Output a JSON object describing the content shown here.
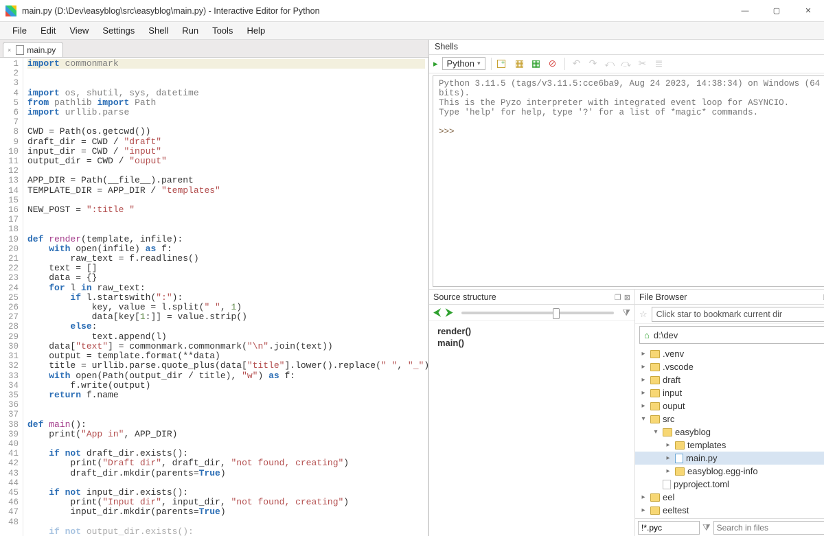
{
  "window": {
    "title": "main.py (D:\\Dev\\easyblog\\src\\easyblog\\main.py) - Interactive Editor for Python"
  },
  "menu": {
    "items": [
      "File",
      "Edit",
      "View",
      "Settings",
      "Shell",
      "Run",
      "Tools",
      "Help"
    ]
  },
  "tab": {
    "filename": "main.py"
  },
  "code_lines": [
    {
      "n": 1,
      "html": "<span class='kw'>import</span> <span class='ident'>commonmark</span>",
      "hl": true
    },
    {
      "n": 2,
      "html": ""
    },
    {
      "n": 3,
      "html": "<span class='kw'>import</span> <span class='ident'>os, shutil, sys, datetime</span>"
    },
    {
      "n": 4,
      "html": "<span class='kw'>from</span> <span class='ident'>pathlib</span> <span class='kw'>import</span> <span class='ident'>Path</span>"
    },
    {
      "n": 5,
      "html": "<span class='kw'>import</span> <span class='ident'>urllib.parse</span>"
    },
    {
      "n": 6,
      "html": ""
    },
    {
      "n": 7,
      "html": "CWD = Path(os.getcwd())"
    },
    {
      "n": 8,
      "html": "draft_dir = CWD / <span class='str'>\"draft\"</span>"
    },
    {
      "n": 9,
      "html": "input_dir = CWD / <span class='str'>\"input\"</span>"
    },
    {
      "n": 10,
      "html": "output_dir = CWD / <span class='str'>\"ouput\"</span>"
    },
    {
      "n": 11,
      "html": ""
    },
    {
      "n": 12,
      "html": "APP_DIR = Path(__file__).parent"
    },
    {
      "n": 13,
      "html": "TEMPLATE_DIR = APP_DIR / <span class='str'>\"templates\"</span>"
    },
    {
      "n": 14,
      "html": ""
    },
    {
      "n": 15,
      "html": "NEW_POST = <span class='str'>\":title \"</span>"
    },
    {
      "n": 16,
      "html": ""
    },
    {
      "n": 17,
      "html": ""
    },
    {
      "n": 18,
      "html": "<span class='kw'>def</span> <span class='fn'>render</span>(template, infile):"
    },
    {
      "n": 19,
      "html": "    <span class='kw'>with</span> open(infile) <span class='kw'>as</span> f:"
    },
    {
      "n": 20,
      "html": "        raw_text = f.readlines()"
    },
    {
      "n": 21,
      "html": "    text = []"
    },
    {
      "n": 22,
      "html": "    data = {}"
    },
    {
      "n": 23,
      "html": "    <span class='kw'>for</span> l <span class='kw'>in</span> raw_text:"
    },
    {
      "n": 24,
      "html": "        <span class='kw'>if</span> l.startswith(<span class='str'>\":\"</span>):"
    },
    {
      "n": 25,
      "html": "            key, value = l.split(<span class='str'>\" \"</span>, <span class='pl'>1</span>)"
    },
    {
      "n": 26,
      "html": "            data[key[<span class='pl'>1</span>:]] = value.strip()"
    },
    {
      "n": 27,
      "html": "        <span class='kw'>else</span>:"
    },
    {
      "n": 28,
      "html": "            text.append(l)"
    },
    {
      "n": 29,
      "html": "    data[<span class='str'>\"text\"</span>] = commonmark.commonmark(<span class='str'>\"\\n\"</span>.join(text))"
    },
    {
      "n": 30,
      "html": "    output = template.format(**data)"
    },
    {
      "n": 31,
      "html": "    title = urllib.parse.quote_plus(data[<span class='str'>\"title\"</span>].lower().replace(<span class='str'>\" \"</span>, <span class='str'>\"_\"</span>)) + <span class='str'>\".html\"</span>"
    },
    {
      "n": 32,
      "html": "    <span class='kw'>with</span> open(Path(output_dir / title), <span class='str'>\"w\"</span>) <span class='kw'>as</span> f:"
    },
    {
      "n": 33,
      "html": "        f.write(output)"
    },
    {
      "n": 34,
      "html": "    <span class='kw'>return</span> f.name"
    },
    {
      "n": 35,
      "html": ""
    },
    {
      "n": 36,
      "html": ""
    },
    {
      "n": 37,
      "html": "<span class='kw'>def</span> <span class='fn'>main</span>():"
    },
    {
      "n": 38,
      "html": "    print(<span class='str'>\"App in\"</span>, APP_DIR)"
    },
    {
      "n": 39,
      "html": ""
    },
    {
      "n": 40,
      "html": "    <span class='kw'>if not</span> draft_dir.exists():"
    },
    {
      "n": 41,
      "html": "        print(<span class='str'>\"Draft dir\"</span>, draft_dir, <span class='str'>\"not found, creating\"</span>)"
    },
    {
      "n": 42,
      "html": "        draft_dir.mkdir(parents=<span class='cons'>True</span>)"
    },
    {
      "n": 43,
      "html": ""
    },
    {
      "n": 44,
      "html": "    <span class='kw'>if not</span> input_dir.exists():"
    },
    {
      "n": 45,
      "html": "        print(<span class='str'>\"Input dir\"</span>, input_dir, <span class='str'>\"not found, creating\"</span>)"
    },
    {
      "n": 46,
      "html": "        input_dir.mkdir(parents=<span class='cons'>True</span>)"
    },
    {
      "n": 47,
      "html": ""
    },
    {
      "n": 48,
      "html": "    <span class='kw'>if not</span> output_dir.exists():",
      "fade": true
    }
  ],
  "shells_label": "Shells",
  "shell_selector": "Python",
  "shell_output": [
    "Python 3.11.5 (tags/v3.11.5:cce6ba9, Aug 24 2023, 14:38:34) on Windows (64 bits).",
    "This is the Pyzo interpreter with integrated event loop for ASYNCIO.",
    "Type 'help' for help, type '?' for a list of *magic* commands."
  ],
  "shell_prompt": ">>>",
  "source_structure": {
    "title": "Source structure",
    "items": [
      "render()",
      "main()"
    ]
  },
  "file_browser": {
    "title": "File Browser",
    "bookmark_placeholder": "Click star to bookmark current dir",
    "path": "d:\\dev",
    "tree": [
      {
        "depth": 0,
        "exp": "▸",
        "icon": "fldr",
        "label": ".venv"
      },
      {
        "depth": 0,
        "exp": "▸",
        "icon": "fldr",
        "label": ".vscode"
      },
      {
        "depth": 0,
        "exp": "▸",
        "icon": "fldr",
        "label": "draft"
      },
      {
        "depth": 0,
        "exp": "▸",
        "icon": "fldr",
        "label": "input"
      },
      {
        "depth": 0,
        "exp": "▸",
        "icon": "fldr",
        "label": "ouput"
      },
      {
        "depth": 0,
        "exp": "▾",
        "icon": "fldr",
        "label": "src"
      },
      {
        "depth": 1,
        "exp": "▾",
        "icon": "fldr",
        "label": "easyblog"
      },
      {
        "depth": 2,
        "exp": "▸",
        "icon": "fldr",
        "label": "templates"
      },
      {
        "depth": 2,
        "exp": "▸",
        "icon": "pyf",
        "label": "main.py",
        "sel": true
      },
      {
        "depth": 2,
        "exp": "▸",
        "icon": "fldr",
        "label": "easyblog.egg-info"
      },
      {
        "depth": 1,
        "exp": "",
        "icon": "doc",
        "label": "pyproject.toml"
      },
      {
        "depth": 0,
        "exp": "▸",
        "icon": "fldr",
        "label": "eel"
      },
      {
        "depth": 0,
        "exp": "▸",
        "icon": "fldr",
        "label": "eeltest"
      }
    ],
    "filter_value": "!*.pyc",
    "search_placeholder": "Search in files"
  }
}
